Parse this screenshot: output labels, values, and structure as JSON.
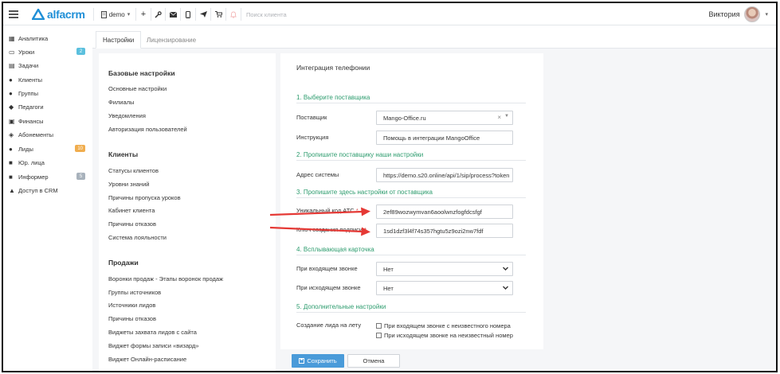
{
  "brand": {
    "name": "alfacrm",
    "color": "#1f8fd7"
  },
  "topbar": {
    "branch": "demo",
    "search_placeholder": "Поиск клиента",
    "user_name": "Виктория",
    "icons": [
      "plus-icon",
      "wrench-icon",
      "mail-icon",
      "phone-icon",
      "send-icon",
      "cart-icon",
      "bell-icon"
    ]
  },
  "sidebar": {
    "items": [
      {
        "label": "Аналитика",
        "icon": "dashboard-icon"
      },
      {
        "label": "Уроки",
        "icon": "calendar-icon",
        "badge": "2",
        "badge_color": "#5bc0de"
      },
      {
        "label": "Задачи",
        "icon": "tasks-icon"
      },
      {
        "label": "Клиенты",
        "icon": "user-icon"
      },
      {
        "label": "Группы",
        "icon": "users-icon"
      },
      {
        "label": "Педагоги",
        "icon": "graduation-cap-icon"
      },
      {
        "label": "Финансы",
        "icon": "money-icon"
      },
      {
        "label": "Абонементы",
        "icon": "tag-icon"
      },
      {
        "label": "Лиды",
        "icon": "user-plus-icon",
        "badge": "10",
        "badge_color": "#f0ad4e"
      },
      {
        "label": "Юр. лица",
        "icon": "briefcase-icon"
      },
      {
        "label": "Информер",
        "icon": "archive-icon",
        "badge": "5",
        "badge_color": "#a8b2bc"
      },
      {
        "label": "Доступ в CRM",
        "icon": "lock-icon"
      }
    ]
  },
  "tabs": {
    "settings": "Настройки",
    "licensing": "Лицензирование"
  },
  "left": {
    "base_heading": "Базовые настройки",
    "base_links": [
      "Основные настройки",
      "Филиалы",
      "Уведомления",
      "Авторизация пользователей"
    ],
    "clients_heading": "Клиенты",
    "clients_links": [
      "Статусы клиентов",
      "Уровни знаний",
      "Причины пропуска уроков",
      "Кабинет клиента",
      "Причины отказов",
      "Система лояльности"
    ],
    "sales_heading": "Продажи",
    "sales_links": [
      "Воронки продаж - Этапы воронок продаж",
      "Группы источников",
      "Источники лидов",
      "Причины отказов",
      "Виджеты захвата лидов с сайта",
      "Виджет формы записи «визард»",
      "Виджет Онлайн-расписание"
    ]
  },
  "form": {
    "title": "Интеграция телефонии",
    "sec1": "1. Выберите поставщика",
    "provider_label": "Поставщик",
    "provider_value": "Mango-Office.ru",
    "instruction_label": "Инструкция",
    "instruction_value": "Помощь в интеграции MangoOffice",
    "sec2": "2. Пропишите поставщику наши настройки",
    "address_label": "Адрес системы",
    "address_value": "https://demo.s20.online/api/1/sip/process?token",
    "sec3": "3. Пропишите здесь настройки от поставщика",
    "ats_label": "Уникальный код АТС",
    "ats_value": "2ef89wozwymvan6aoolwnzfogfdcsfgf",
    "sign_label": "Ключ создания подписи",
    "sign_value": "1sd1dzf3l4f74s357hgtu5z9ozi2nw7fdf",
    "required_mark": "*",
    "sec4": "4. Всплывающая карточка",
    "incoming_label": "При входящем звонке",
    "incoming_value": "Нет",
    "outgoing_label": "При исходящем звонке",
    "outgoing_value": "Нет",
    "sec5": "5. Дополнительные настройки",
    "lead_label": "Создание лида на лету",
    "check_incoming": "При входящем звонке с неизвестного номера",
    "check_outgoing": "При исходящем звонке на неизвестный номер"
  },
  "footer": {
    "save": "Сохранить",
    "cancel": "Отмена"
  },
  "colors": {
    "section": "#2d9c6e",
    "save_button": "#4a9bd9",
    "annotation_arrow": "#e53935"
  }
}
